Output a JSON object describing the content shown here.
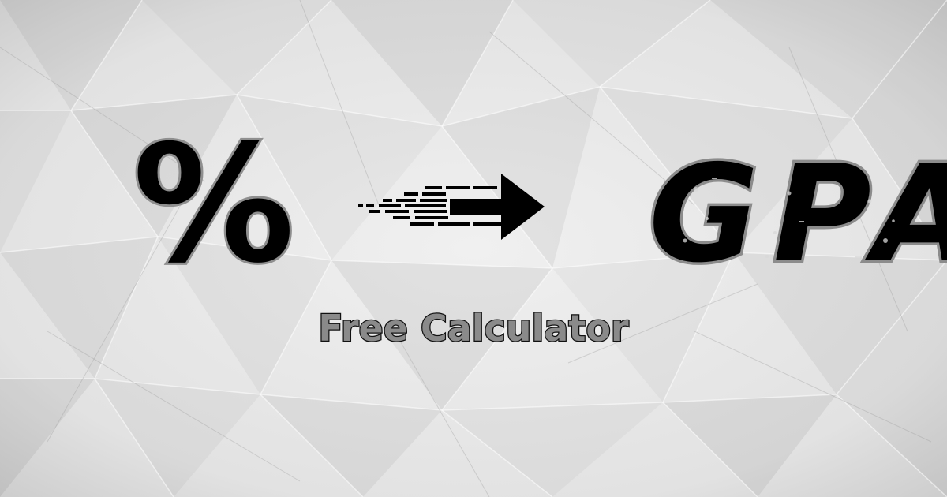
{
  "banner": {
    "from_symbol": "%",
    "to_label": "GPA",
    "tagline": "Free Calculator",
    "icons": {
      "arrow": "speed-arrow-right-icon"
    }
  },
  "colors": {
    "paper_light": "#e9e9e9",
    "paper_dark": "#cfcfcf",
    "glyph_fill": "#000000",
    "glyph_outline": "#8f8f8f",
    "tagline_fill": "#8a8a8a",
    "tagline_outline": "#111111"
  }
}
